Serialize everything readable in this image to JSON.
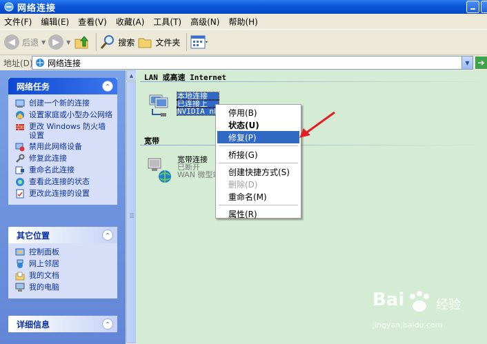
{
  "window": {
    "title": "网络连接"
  },
  "menubar": [
    "文件(F)",
    "编辑(E)",
    "查看(V)",
    "收藏(A)",
    "工具(T)",
    "高级(N)",
    "帮助(H)"
  ],
  "toolbar": {
    "back": "后退",
    "search": "搜索",
    "folders": "文件夹"
  },
  "address": {
    "label": "地址(D)",
    "value": "网络连接"
  },
  "panels": {
    "network_tasks": {
      "title": "网络任务",
      "items": [
        "创建一个新的连接",
        "设置家庭或小型办公网络",
        "更改 Windows 防火墙设置",
        "禁用此网络设备",
        "修复此连接",
        "重命名此连接",
        "查看此连接的状态",
        "更改此连接的设置"
      ]
    },
    "other_places": {
      "title": "其它位置",
      "items": [
        "控制面板",
        "网上邻居",
        "我的文档",
        "我的电脑"
      ]
    },
    "details": {
      "title": "详细信息"
    }
  },
  "content": {
    "group_lan": "LAN 或高速 Internet",
    "lan_conn": {
      "name": "本地连接",
      "status": "已连接上",
      "device": "NVIDIA nF"
    },
    "group_broadband": "宽带",
    "wan_conn": {
      "name": "宽带连接",
      "status": "已断开",
      "device": "WAN 微型端"
    }
  },
  "context_menu": {
    "disable": "停用(B)",
    "status": "状态(U)",
    "repair": "修复(P)",
    "bridge": "桥接(G)",
    "shortcut": "创建快捷方式(S)",
    "delete": "删除(D)",
    "rename": "重命名(M)",
    "properties": "属性(R)"
  },
  "watermark": {
    "brand": "Bai",
    "sub": "经验",
    "url": "jingyan.baidu.com"
  },
  "colors": {
    "accent": "#316ac5",
    "arrow": "#e21e24",
    "pane": "#6f93dc"
  }
}
